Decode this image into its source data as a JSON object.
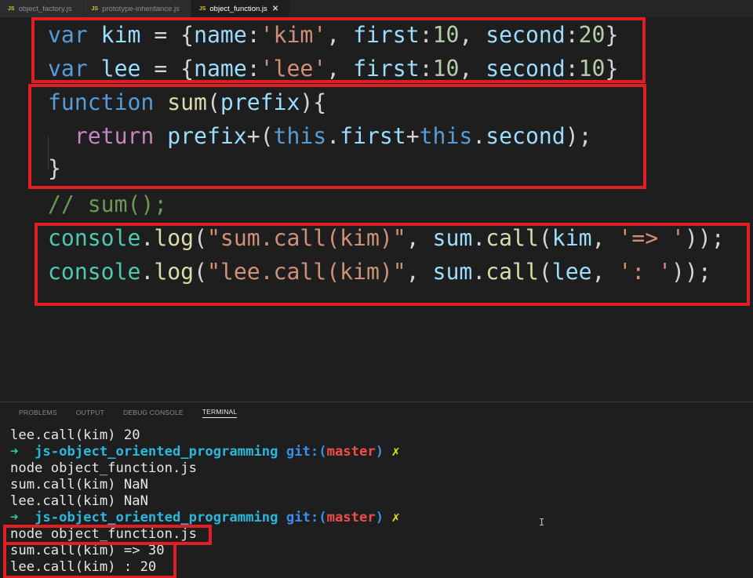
{
  "tabs": [
    {
      "icon": "JS",
      "label": "object_factory.js",
      "active": false
    },
    {
      "icon": "JS",
      "label": "prototype-inheritance.js",
      "active": false
    },
    {
      "icon": "JS",
      "label": "object_function.js",
      "active": true,
      "close": "✕"
    }
  ],
  "code": {
    "l1": {
      "kw": "var",
      "name": "kim",
      "eq": " = {",
      "k1": "name",
      "v1": "'kim'",
      "k2": "first",
      "v2": "10",
      "k3": "second",
      "v3": "20",
      "end": "}"
    },
    "l2": {
      "kw": "var",
      "name": "lee",
      "eq": " = {",
      "k1": "name",
      "v1": "'lee'",
      "k2": "first",
      "v2": "10",
      "k3": "second",
      "v3": "10",
      "end": "}"
    },
    "l3": {
      "kw": "function",
      "fn": "sum",
      "open": "(",
      "param": "prefix",
      "close": "){"
    },
    "l4": {
      "kw": "return",
      "a": "prefix",
      "b": "+(",
      "this1": "this",
      "d1": ".",
      "p1": "first",
      "plus": "+",
      "this2": "this",
      "d2": ".",
      "p2": "second",
      "end": ");"
    },
    "l5": {
      "brace": "}"
    },
    "l6": {
      "comment": "// sum();"
    },
    "l7": {
      "obj": "console",
      "dot": ".",
      "fn": "log",
      "open": "(",
      "str": "\"sum.call(kim)\"",
      "comma": ", ",
      "fn2obj": "sum",
      "dot2": ".",
      "fn2": "call",
      "open2": "(",
      "arg": "kim",
      "comma2": ", ",
      "str2": "'=> '",
      "end": "));"
    },
    "l8": {
      "obj": "console",
      "dot": ".",
      "fn": "log",
      "open": "(",
      "str": "\"lee.call(kim)\"",
      "comma": ", ",
      "fn2obj": "sum",
      "dot2": ".",
      "fn2": "call",
      "open2": "(",
      "arg": "lee",
      "comma2": ", ",
      "str2": "': '",
      "end": "));"
    }
  },
  "panel": {
    "tabs": [
      "PROBLEMS",
      "OUTPUT",
      "DEBUG CONSOLE",
      "TERMINAL"
    ],
    "active_tab": "TERMINAL"
  },
  "terminal": {
    "line1": "lee.call(kim) 20",
    "prompt": {
      "arrow": "➜",
      "dir": "js-object_oriented_programming",
      "git": "git:(",
      "branch": "master",
      "gitclose": ")",
      "x": "✗"
    },
    "line3": "node object_function.js",
    "line4": "sum.call(kim) NaN",
    "line5": "lee.call(kim) NaN",
    "line7": "node object_function.js",
    "line8": "sum.call(kim) => 30",
    "line9": "lee.call(kim) : 20",
    "cursor": "I"
  },
  "colors": {
    "highlight": "#e01e24",
    "keyword": "#569cd6",
    "string": "#ce9178",
    "number": "#b5cea8"
  }
}
